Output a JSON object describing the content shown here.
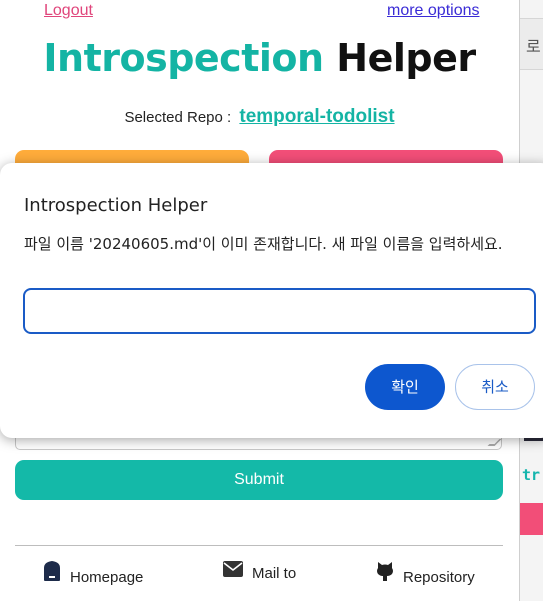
{
  "background_page": {
    "tab_char": "로"
  },
  "popup": {
    "logout_label": "Logout",
    "more_options_label": "more options",
    "title_part1": "Introspection",
    "title_part2": "Helper",
    "selected_repo_label": "Selected Repo :",
    "selected_repo_name": "temporal-todolist",
    "submit_label": "Submit",
    "footer": {
      "homepage_label": "Homepage",
      "mail_label": "Mail to",
      "repository_label": "Repository"
    }
  },
  "dialog": {
    "title": "Introspection Helper",
    "message": "파일 이름 '20240605.md'이 이미 존재합니다. 새 파일 이름을 입력하세요.",
    "input_value": "",
    "confirm_label": "확인",
    "cancel_label": "취소"
  },
  "colors": {
    "accent_teal": "#14b4a4",
    "orange": "#ffac3b",
    "pink": "#f24e78",
    "dialog_primary": "#0d57cf"
  }
}
